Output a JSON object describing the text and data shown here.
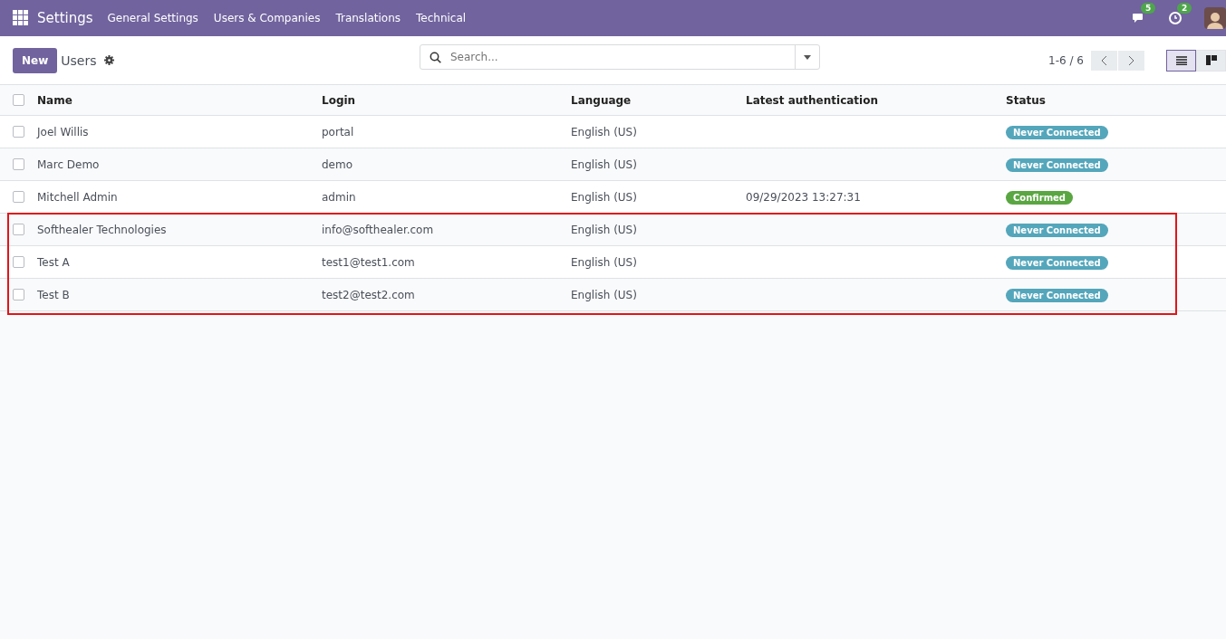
{
  "navbar": {
    "app": "Settings",
    "menus": [
      "General Settings",
      "Users & Companies",
      "Translations",
      "Technical"
    ],
    "messages_badge": "5",
    "activities_badge": "2"
  },
  "control_panel": {
    "new_button": "New",
    "breadcrumb": "Users",
    "search": {
      "placeholder": "Search..."
    },
    "pager": "1-6 / 6",
    "views": [
      {
        "kind": "list",
        "selected": true
      },
      {
        "kind": "kanban",
        "selected": false
      }
    ]
  },
  "table": {
    "select_all_checked": false,
    "columns": [
      "Name",
      "Login",
      "Language",
      "Latest authentication",
      "Status"
    ],
    "rows": [
      {
        "checked": false,
        "name": "Joel Willis",
        "login": "portal",
        "language": "English (US)",
        "latest": "",
        "status": "Never Connected",
        "color": "#54a6bb",
        "highlighted": false
      },
      {
        "checked": false,
        "name": "Marc Demo",
        "login": "demo",
        "language": "English (US)",
        "latest": "",
        "status": "Never Connected",
        "color": "#54a6bb",
        "highlighted": false
      },
      {
        "checked": false,
        "name": "Mitchell Admin",
        "login": "admin",
        "language": "English (US)",
        "latest": "09/29/2023 13:27:31",
        "status": "Confirmed",
        "color": "#5aa642",
        "highlighted": false
      },
      {
        "checked": false,
        "name": "Softhealer Technologies",
        "login": "info@softhealer.com",
        "language": "English (US)",
        "latest": "",
        "status": "Never Connected",
        "color": "#54a6bb",
        "highlighted": true
      },
      {
        "checked": false,
        "name": "Test A",
        "login": "test1@test1.com",
        "language": "English (US)",
        "latest": "",
        "status": "Never Connected",
        "color": "#54a6bb",
        "highlighted": true
      },
      {
        "checked": false,
        "name": "Test B",
        "login": "test2@test2.com",
        "language": "English (US)",
        "latest": "",
        "status": "Never Connected",
        "color": "#54a6bb",
        "highlighted": true
      }
    ]
  }
}
